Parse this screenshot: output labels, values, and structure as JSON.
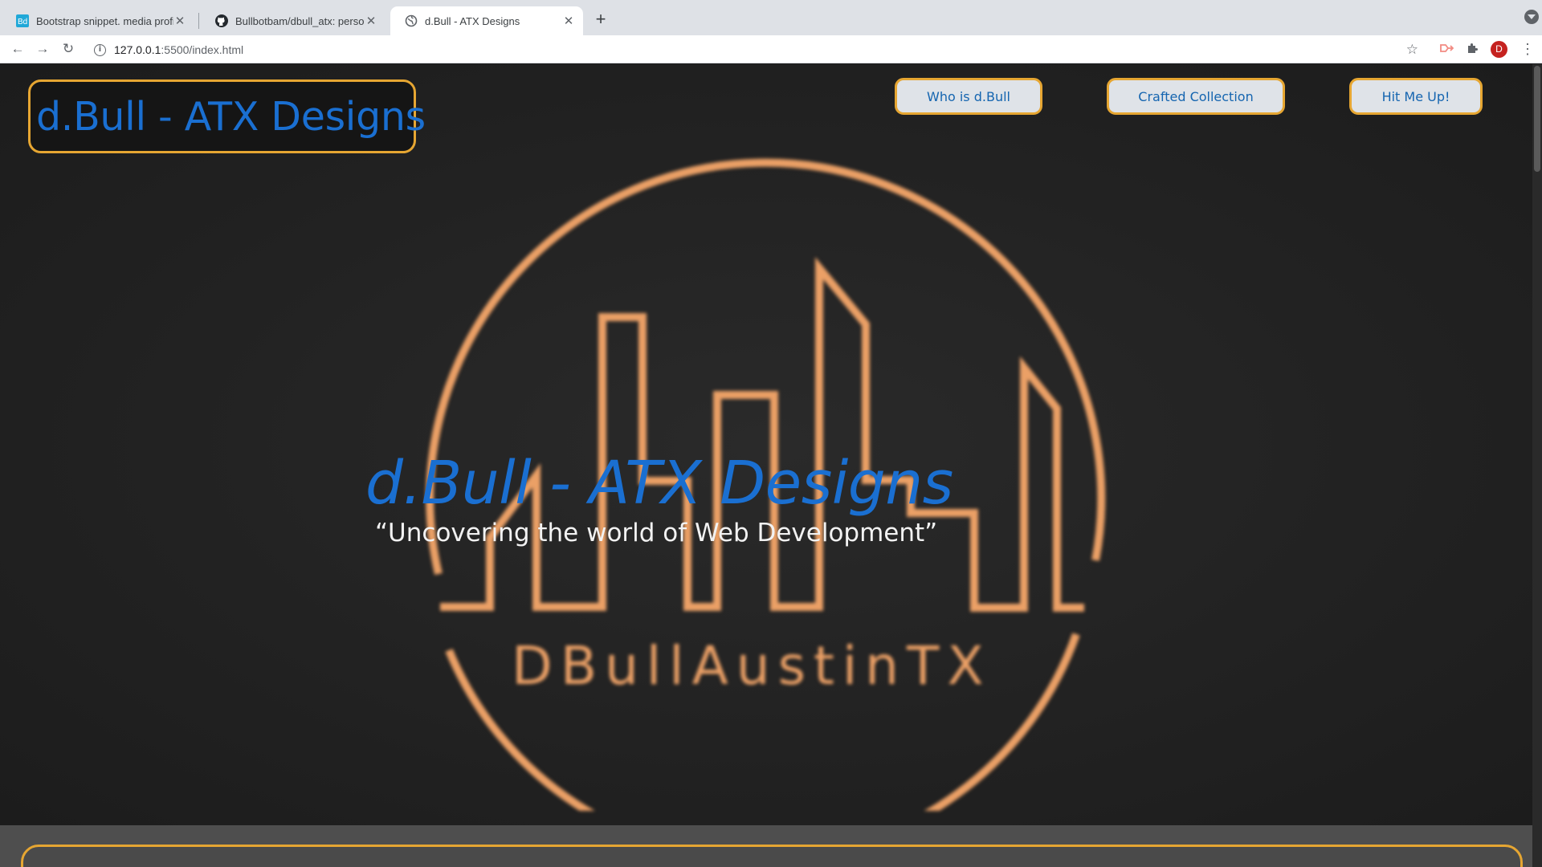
{
  "browser": {
    "tabs": [
      {
        "title": "Bootstrap snippet. media profile",
        "favicon": "bootdey-icon",
        "active": false
      },
      {
        "title": "Bullbotbam/dbull_atx: personal",
        "favicon": "github-icon",
        "active": false
      },
      {
        "title": "d.Bull - ATX Designs",
        "favicon": "globe-icon",
        "active": true
      }
    ],
    "url_host": "127.0.0.1",
    "url_path": ":5500/index.html",
    "avatar_letter": "D"
  },
  "page": {
    "brand": "d.Bull - ATX Designs",
    "nav": [
      {
        "label": "Who is d.Bull"
      },
      {
        "label": "Crafted Collection"
      },
      {
        "label": "Hit Me Up!"
      }
    ],
    "hero": {
      "title": "d.Bull - ATX Designs",
      "quote": "“Uncovering the world of Web Development”",
      "logo_text": "DBullAustinTX"
    }
  },
  "colors": {
    "accent_orange": "#e6a632",
    "logo_orange": "#eba066",
    "brand_blue": "#1a6fd1",
    "nav_bg": "#dfe3e8",
    "background": "#1d1d1e"
  }
}
